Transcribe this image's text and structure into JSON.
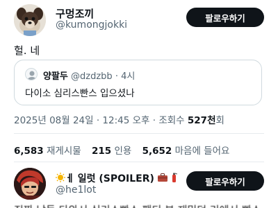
{
  "tweet": {
    "author_name": "구멍조끼",
    "author_handle": "@kumongjokki",
    "follow_label": "팔로우하기",
    "text": "헐. 네",
    "quote": {
      "author_name": "양팔두",
      "author_handle": "@dzdzbb",
      "separator": "·",
      "time": "4시",
      "text": "다이소 심리스빤스 입으셨나"
    },
    "timestamp": "2025년 08월 24일 · 12:45 오후 · 조회수 ",
    "views": "527천",
    "views_suffix": "회",
    "stats": [
      {
        "value": "6,583",
        "label": "재게시물"
      },
      {
        "value": "215",
        "label": "인용"
      },
      {
        "value": "5,652",
        "label": "마음에 들어요"
      }
    ]
  },
  "reply": {
    "author_name": "ㅔ 일럿 (SPOILER)",
    "author_handle": "@he1lot",
    "follow_label": "팔로우하기",
    "text": "진짜 남들 다와서 심리스빤스 팬티 본 재밌던 리에서 빤스",
    "name_icons": [
      "sun-emoji",
      "suitcase-emoji",
      "fire-extinguisher-emoji"
    ],
    "colors": {
      "dark": "#0f1419",
      "muted": "#536471",
      "border": "#cfd9de"
    }
  }
}
